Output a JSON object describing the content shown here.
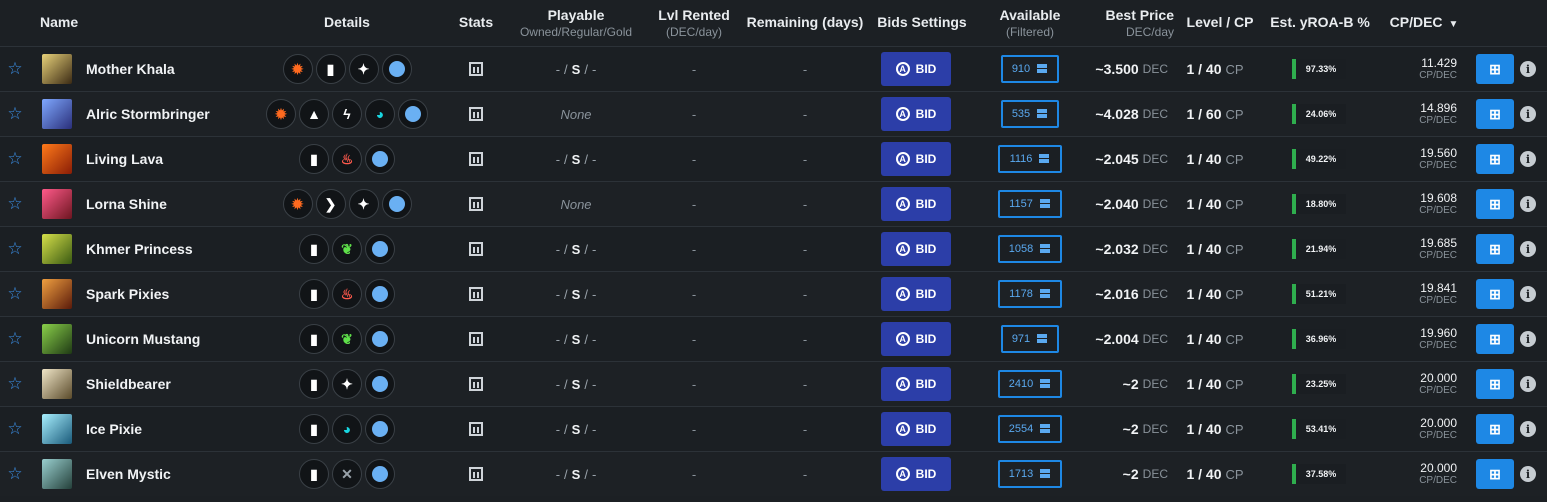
{
  "headers": {
    "name": "Name",
    "details": "Details",
    "stats": "Stats",
    "playable": "Playable",
    "playable_sub": "Owned/Regular/Gold",
    "lvl_rented": "Lvl Rented",
    "lvl_rented_sub": "(DEC/day)",
    "remaining": "Remaining (days)",
    "bids_settings": "Bids Settings",
    "available": "Available",
    "available_sub": "(Filtered)",
    "best_price": "Best Price",
    "best_price_sub": "DEC/day",
    "level_cp": "Level / CP",
    "yroa": "Est. yROA-B %",
    "cpdec": "CP/DEC",
    "sort_icon": "chevron-down-icon"
  },
  "labels": {
    "bid": "BID",
    "bid_icon_letter": "A",
    "dec": "DEC",
    "cp": "CP",
    "cp_unit": "CP/DEC",
    "dash": "-",
    "slash": "/",
    "regular": "S"
  },
  "colors": {
    "accent": "#1e88e5",
    "bid_button": "#2c3ea8",
    "roa_bar": "#2fae4e",
    "star": "#3b8fe6"
  },
  "abilities": {
    "fire-burst": {
      "glyph": "✹",
      "color": "#ff6a1f"
    },
    "shield-bar": {
      "glyph": "▮",
      "color": "#ffffff"
    },
    "crosshair": {
      "glyph": "✦",
      "color": "#ffffff"
    },
    "orb": {
      "glyph": "",
      "color": "#6ab0f3"
    },
    "arrow-up": {
      "glyph": "▲",
      "color": "#ffffff"
    },
    "lightning": {
      "glyph": "ϟ",
      "color": "#ffffff"
    },
    "water-wave": {
      "glyph": "◕",
      "color": "#18d6e0"
    },
    "chevron-right": {
      "glyph": "❯",
      "color": "#ffffff"
    },
    "fire-drop": {
      "glyph": "♨",
      "color": "#ff5a4d"
    },
    "leaf": {
      "glyph": "❦",
      "color": "#5fe04a"
    },
    "crossed-swords": {
      "glyph": "✕",
      "color": "#9aa3ab"
    }
  },
  "rows": [
    {
      "name": "Mother Khala",
      "avatar": [
        "#e8d27a",
        "#3b2a14"
      ],
      "abilities": [
        "fire-burst",
        "shield-bar",
        "crosshair",
        "orb"
      ],
      "playable": "own",
      "available": "910",
      "price_prefix": "~",
      "price": "3.500",
      "level": "1 / 40",
      "roa": "97.33%",
      "cpdec": "11.429"
    },
    {
      "name": "Alric Stormbringer",
      "avatar": [
        "#7fa8ff",
        "#2a2f7a"
      ],
      "abilities": [
        "fire-burst",
        "arrow-up",
        "lightning",
        "water-wave",
        "orb"
      ],
      "playable": "none",
      "playable_text": "None",
      "available": "535",
      "price_prefix": "~",
      "price": "4.028",
      "level": "1 / 60",
      "roa": "24.06%",
      "cpdec": "14.896"
    },
    {
      "name": "Living Lava",
      "avatar": [
        "#ff7a1a",
        "#8a1d06"
      ],
      "abilities": [
        "shield-bar",
        "fire-drop",
        "orb"
      ],
      "playable": "own",
      "available": "1116",
      "price_prefix": "~",
      "price": "2.045",
      "level": "1 / 40",
      "roa": "49.22%",
      "cpdec": "19.560"
    },
    {
      "name": "Lorna Shine",
      "avatar": [
        "#ff5a8a",
        "#6d1520"
      ],
      "abilities": [
        "fire-burst",
        "chevron-right",
        "crosshair",
        "orb"
      ],
      "playable": "none",
      "playable_text": "None",
      "available": "1157",
      "price_prefix": "~",
      "price": "2.040",
      "level": "1 / 40",
      "roa": "18.80%",
      "cpdec": "19.608"
    },
    {
      "name": "Khmer Princess",
      "avatar": [
        "#d6e04a",
        "#3a5a12"
      ],
      "abilities": [
        "shield-bar",
        "leaf",
        "orb"
      ],
      "playable": "own",
      "available": "1058",
      "price_prefix": "~",
      "price": "2.032",
      "level": "1 / 40",
      "roa": "21.94%",
      "cpdec": "19.685"
    },
    {
      "name": "Spark Pixies",
      "avatar": [
        "#f0a040",
        "#5a1a0a"
      ],
      "abilities": [
        "shield-bar",
        "fire-drop",
        "orb"
      ],
      "playable": "own",
      "available": "1178",
      "price_prefix": "~",
      "price": "2.016",
      "level": "1 / 40",
      "roa": "51.21%",
      "cpdec": "19.841"
    },
    {
      "name": "Unicorn Mustang",
      "avatar": [
        "#8ad04a",
        "#1f3a14"
      ],
      "abilities": [
        "shield-bar",
        "leaf",
        "orb"
      ],
      "playable": "own",
      "available": "971",
      "price_prefix": "~",
      "price": "2.004",
      "level": "1 / 40",
      "roa": "36.96%",
      "cpdec": "19.960"
    },
    {
      "name": "Shieldbearer",
      "avatar": [
        "#f0e6c8",
        "#5a4a2a"
      ],
      "abilities": [
        "shield-bar",
        "crosshair",
        "orb"
      ],
      "playable": "own",
      "available": "2410",
      "price_prefix": "~",
      "price": "2",
      "level": "1 / 40",
      "roa": "23.25%",
      "cpdec": "20.000"
    },
    {
      "name": "Ice Pixie",
      "avatar": [
        "#a8f0ff",
        "#1a5a7a"
      ],
      "abilities": [
        "shield-bar",
        "water-wave",
        "orb"
      ],
      "playable": "own",
      "available": "2554",
      "price_prefix": "~",
      "price": "2",
      "level": "1 / 40",
      "roa": "53.41%",
      "cpdec": "20.000"
    },
    {
      "name": "Elven Mystic",
      "avatar": [
        "#9ad0d0",
        "#24403a"
      ],
      "abilities": [
        "shield-bar",
        "crossed-swords",
        "orb"
      ],
      "playable": "own",
      "available": "1713",
      "price_prefix": "~",
      "price": "2",
      "level": "1 / 40",
      "roa": "37.58%",
      "cpdec": "20.000"
    }
  ]
}
